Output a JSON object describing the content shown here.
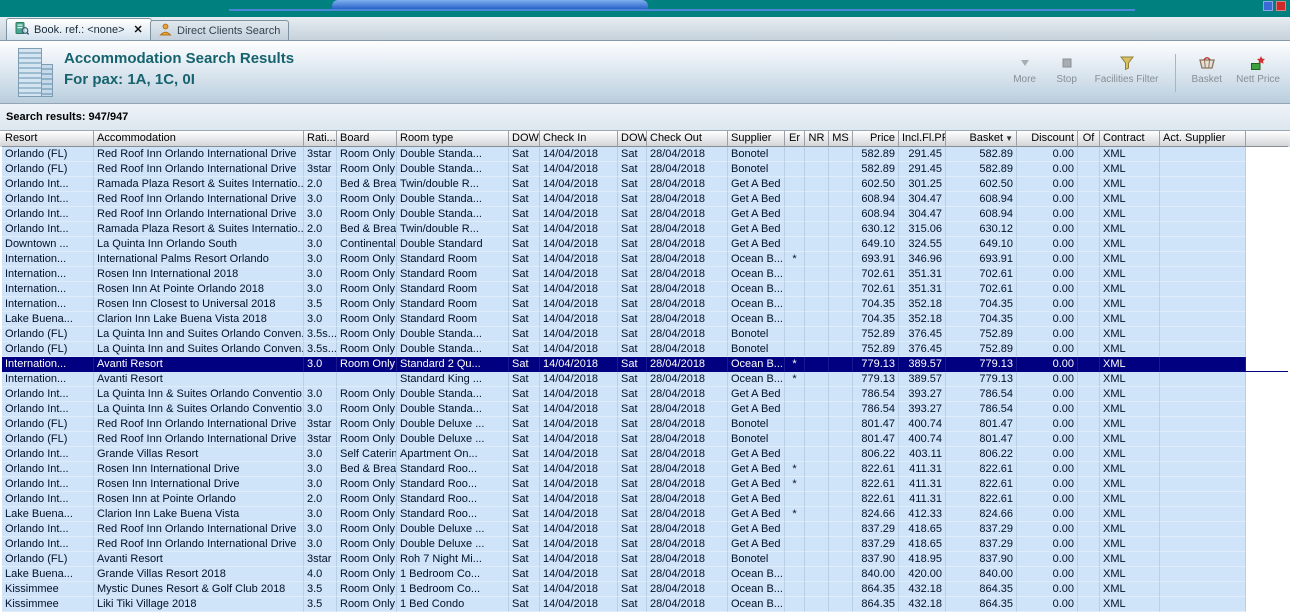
{
  "tabs": [
    {
      "label": "Book. ref.: <none>",
      "close_label": "✕"
    },
    {
      "label": "Direct Clients Search"
    }
  ],
  "header": {
    "title": "Accommodation Search Results",
    "subtitle": "For pax: 1A, 1C, 0I",
    "toolbar": [
      {
        "label": "More"
      },
      {
        "label": "Stop"
      },
      {
        "label": "Facilities Filter"
      },
      {
        "label": "Basket"
      },
      {
        "label": "Nett Price"
      }
    ]
  },
  "results_label": "Search results: 947/947",
  "table": {
    "columns": [
      "Resort",
      "Accommodation",
      "Rati...",
      "Board",
      "Room type",
      "DOW",
      "Check In",
      "DOW",
      "Check Out",
      "Supplier",
      "Er",
      "NR",
      "MS",
      "Price",
      "Incl.Fl.PP",
      "Basket",
      "Discount",
      "Of",
      "Contract",
      "Act. Supplier"
    ],
    "sort_column_index": 15,
    "sort_indicator": "▼",
    "selected_row_index": 14,
    "rows": [
      [
        "Orlando (FL)",
        "Red Roof Inn Orlando International Drive",
        "3star",
        "Room Only",
        "Double Standa...",
        "Sat",
        "14/04/2018",
        "Sat",
        "28/04/2018",
        "Bonotel",
        "",
        "",
        "",
        "582.89",
        "291.45",
        "582.89",
        "0.00",
        "",
        "XML",
        ""
      ],
      [
        "Orlando (FL)",
        "Red Roof Inn Orlando International Drive",
        "3star",
        "Room Only",
        "Double Standa...",
        "Sat",
        "14/04/2018",
        "Sat",
        "28/04/2018",
        "Bonotel",
        "",
        "",
        "",
        "582.89",
        "291.45",
        "582.89",
        "0.00",
        "",
        "XML",
        ""
      ],
      [
        "Orlando Int...",
        "Ramada Plaza Resort & Suites Internatio...",
        "2.0",
        "Bed & Brea...",
        "Twin/double R...",
        "Sat",
        "14/04/2018",
        "Sat",
        "28/04/2018",
        "Get A Bed",
        "",
        "",
        "",
        "602.50",
        "301.25",
        "602.50",
        "0.00",
        "",
        "XML",
        ""
      ],
      [
        "Orlando Int...",
        "Red Roof Inn Orlando International Drive",
        "3.0",
        "Room Only",
        "Double Standa...",
        "Sat",
        "14/04/2018",
        "Sat",
        "28/04/2018",
        "Get A Bed",
        "",
        "",
        "",
        "608.94",
        "304.47",
        "608.94",
        "0.00",
        "",
        "XML",
        ""
      ],
      [
        "Orlando Int...",
        "Red Roof Inn Orlando International Drive",
        "3.0",
        "Room Only",
        "Double Standa...",
        "Sat",
        "14/04/2018",
        "Sat",
        "28/04/2018",
        "Get A Bed",
        "",
        "",
        "",
        "608.94",
        "304.47",
        "608.94",
        "0.00",
        "",
        "XML",
        ""
      ],
      [
        "Orlando Int...",
        "Ramada Plaza Resort & Suites Internatio...",
        "2.0",
        "Bed & Brea...",
        "Twin/double R...",
        "Sat",
        "14/04/2018",
        "Sat",
        "28/04/2018",
        "Get A Bed",
        "",
        "",
        "",
        "630.12",
        "315.06",
        "630.12",
        "0.00",
        "",
        "XML",
        ""
      ],
      [
        "Downtown ...",
        "La Quinta Inn Orlando South",
        "3.0",
        "Continental...",
        "Double Standard",
        "Sat",
        "14/04/2018",
        "Sat",
        "28/04/2018",
        "Get A Bed",
        "",
        "",
        "",
        "649.10",
        "324.55",
        "649.10",
        "0.00",
        "",
        "XML",
        ""
      ],
      [
        "Internation...",
        "International Palms Resort Orlando",
        "3.0",
        "Room Only",
        "Standard Room",
        "Sat",
        "14/04/2018",
        "Sat",
        "28/04/2018",
        "Ocean B...",
        "*",
        "",
        "",
        "693.91",
        "346.96",
        "693.91",
        "0.00",
        "",
        "XML",
        ""
      ],
      [
        "Internation...",
        "Rosen Inn International 2018",
        "3.0",
        "Room Only",
        "Standard Room",
        "Sat",
        "14/04/2018",
        "Sat",
        "28/04/2018",
        "Ocean B...",
        "",
        "",
        "",
        "702.61",
        "351.31",
        "702.61",
        "0.00",
        "",
        "XML",
        ""
      ],
      [
        "Internation...",
        "Rosen Inn At Pointe Orlando 2018",
        "3.0",
        "Room Only",
        "Standard Room",
        "Sat",
        "14/04/2018",
        "Sat",
        "28/04/2018",
        "Ocean B...",
        "",
        "",
        "",
        "702.61",
        "351.31",
        "702.61",
        "0.00",
        "",
        "XML",
        ""
      ],
      [
        "Internation...",
        "Rosen Inn Closest to Universal 2018",
        "3.5",
        "Room Only",
        "Standard Room",
        "Sat",
        "14/04/2018",
        "Sat",
        "28/04/2018",
        "Ocean B...",
        "",
        "",
        "",
        "704.35",
        "352.18",
        "704.35",
        "0.00",
        "",
        "XML",
        ""
      ],
      [
        "Lake Buena...",
        "Clarion Inn Lake Buena Vista 2018",
        "3.0",
        "Room Only",
        "Standard Room",
        "Sat",
        "14/04/2018",
        "Sat",
        "28/04/2018",
        "Ocean B...",
        "",
        "",
        "",
        "704.35",
        "352.18",
        "704.35",
        "0.00",
        "",
        "XML",
        ""
      ],
      [
        "Orlando (FL)",
        "La Quinta Inn and Suites Orlando Conven...",
        "3.5s...",
        "Room Only",
        "Double Standa...",
        "Sat",
        "14/04/2018",
        "Sat",
        "28/04/2018",
        "Bonotel",
        "",
        "",
        "",
        "752.89",
        "376.45",
        "752.89",
        "0.00",
        "",
        "XML",
        ""
      ],
      [
        "Orlando (FL)",
        "La Quinta Inn and Suites Orlando Conven...",
        "3.5s...",
        "Room Only",
        "Double Standa...",
        "Sat",
        "14/04/2018",
        "Sat",
        "28/04/2018",
        "Bonotel",
        "",
        "",
        "",
        "752.89",
        "376.45",
        "752.89",
        "0.00",
        "",
        "XML",
        ""
      ],
      [
        "Internation...",
        "Avanti Resort",
        "3.0",
        "Room Only",
        "Standard 2 Qu...",
        "Sat",
        "14/04/2018",
        "Sat",
        "28/04/2018",
        "Ocean B...",
        "*",
        "",
        "",
        "779.13",
        "389.57",
        "779.13",
        "0.00",
        "",
        "XML",
        ""
      ],
      [
        "Internation...",
        "Avanti Resort",
        "",
        "",
        "Standard King ...",
        "Sat",
        "14/04/2018",
        "Sat",
        "28/04/2018",
        "Ocean B...",
        "*",
        "",
        "",
        "779.13",
        "389.57",
        "779.13",
        "0.00",
        "",
        "XML",
        ""
      ],
      [
        "Orlando Int...",
        "La Quinta Inn & Suites Orlando Conventio...",
        "3.0",
        "Room Only",
        "Double Standa...",
        "Sat",
        "14/04/2018",
        "Sat",
        "28/04/2018",
        "Get A Bed",
        "",
        "",
        "",
        "786.54",
        "393.27",
        "786.54",
        "0.00",
        "",
        "XML",
        ""
      ],
      [
        "Orlando Int...",
        "La Quinta Inn & Suites Orlando Conventio...",
        "3.0",
        "Room Only",
        "Double Standa...",
        "Sat",
        "14/04/2018",
        "Sat",
        "28/04/2018",
        "Get A Bed",
        "",
        "",
        "",
        "786.54",
        "393.27",
        "786.54",
        "0.00",
        "",
        "XML",
        ""
      ],
      [
        "Orlando (FL)",
        "Red Roof Inn Orlando International Drive",
        "3star",
        "Room Only",
        "Double Deluxe ...",
        "Sat",
        "14/04/2018",
        "Sat",
        "28/04/2018",
        "Bonotel",
        "",
        "",
        "",
        "801.47",
        "400.74",
        "801.47",
        "0.00",
        "",
        "XML",
        ""
      ],
      [
        "Orlando (FL)",
        "Red Roof Inn Orlando International Drive",
        "3star",
        "Room Only",
        "Double Deluxe ...",
        "Sat",
        "14/04/2018",
        "Sat",
        "28/04/2018",
        "Bonotel",
        "",
        "",
        "",
        "801.47",
        "400.74",
        "801.47",
        "0.00",
        "",
        "XML",
        ""
      ],
      [
        "Orlando Int...",
        "Grande Villas Resort",
        "3.0",
        "Self Catering",
        "Apartment On...",
        "Sat",
        "14/04/2018",
        "Sat",
        "28/04/2018",
        "Get A Bed",
        "",
        "",
        "",
        "806.22",
        "403.11",
        "806.22",
        "0.00",
        "",
        "XML",
        ""
      ],
      [
        "Orlando Int...",
        "Rosen Inn International Drive",
        "3.0",
        "Bed & Brea...",
        "Standard Roo...",
        "Sat",
        "14/04/2018",
        "Sat",
        "28/04/2018",
        "Get A Bed",
        "*",
        "",
        "",
        "822.61",
        "411.31",
        "822.61",
        "0.00",
        "",
        "XML",
        ""
      ],
      [
        "Orlando Int...",
        "Rosen Inn International Drive",
        "3.0",
        "Room Only",
        "Standard Roo...",
        "Sat",
        "14/04/2018",
        "Sat",
        "28/04/2018",
        "Get A Bed",
        "*",
        "",
        "",
        "822.61",
        "411.31",
        "822.61",
        "0.00",
        "",
        "XML",
        ""
      ],
      [
        "Orlando Int...",
        "Rosen Inn at Pointe Orlando",
        "2.0",
        "Room Only",
        "Standard Roo...",
        "Sat",
        "14/04/2018",
        "Sat",
        "28/04/2018",
        "Get A Bed",
        "",
        "",
        "",
        "822.61",
        "411.31",
        "822.61",
        "0.00",
        "",
        "XML",
        ""
      ],
      [
        "Lake Buena...",
        "Clarion Inn Lake Buena Vista",
        "3.0",
        "Room Only",
        "Standard Roo...",
        "Sat",
        "14/04/2018",
        "Sat",
        "28/04/2018",
        "Get A Bed",
        "*",
        "",
        "",
        "824.66",
        "412.33",
        "824.66",
        "0.00",
        "",
        "XML",
        ""
      ],
      [
        "Orlando Int...",
        "Red Roof Inn Orlando International Drive",
        "3.0",
        "Room Only",
        "Double Deluxe ...",
        "Sat",
        "14/04/2018",
        "Sat",
        "28/04/2018",
        "Get A Bed",
        "",
        "",
        "",
        "837.29",
        "418.65",
        "837.29",
        "0.00",
        "",
        "XML",
        ""
      ],
      [
        "Orlando Int...",
        "Red Roof Inn Orlando International Drive",
        "3.0",
        "Room Only",
        "Double Deluxe ...",
        "Sat",
        "14/04/2018",
        "Sat",
        "28/04/2018",
        "Get A Bed",
        "",
        "",
        "",
        "837.29",
        "418.65",
        "837.29",
        "0.00",
        "",
        "XML",
        ""
      ],
      [
        "Orlando (FL)",
        "Avanti Resort",
        "3star",
        "Room Only",
        "Roh 7 Night Mi...",
        "Sat",
        "14/04/2018",
        "Sat",
        "28/04/2018",
        "Bonotel",
        "",
        "",
        "",
        "837.90",
        "418.95",
        "837.90",
        "0.00",
        "",
        "XML",
        ""
      ],
      [
        "Lake Buena...",
        "Grande Villas Resort 2018",
        "4.0",
        "Room Only",
        "1 Bedroom Co...",
        "Sat",
        "14/04/2018",
        "Sat",
        "28/04/2018",
        "Ocean B...",
        "",
        "",
        "",
        "840.00",
        "420.00",
        "840.00",
        "0.00",
        "",
        "XML",
        ""
      ],
      [
        "Kissimmee",
        "Mystic Dunes Resort & Golf Club 2018",
        "3.5",
        "Room Only",
        "1 Bedroom Co...",
        "Sat",
        "14/04/2018",
        "Sat",
        "28/04/2018",
        "Ocean B...",
        "",
        "",
        "",
        "864.35",
        "432.18",
        "864.35",
        "0.00",
        "",
        "XML",
        ""
      ],
      [
        "Kissimmee",
        "Liki Tiki Village 2018",
        "3.5",
        "Room Only",
        "1 Bed Condo",
        "Sat",
        "14/04/2018",
        "Sat",
        "28/04/2018",
        "Ocean B...",
        "",
        "",
        "",
        "864.35",
        "432.18",
        "864.35",
        "0.00",
        "",
        "XML",
        ""
      ]
    ]
  }
}
